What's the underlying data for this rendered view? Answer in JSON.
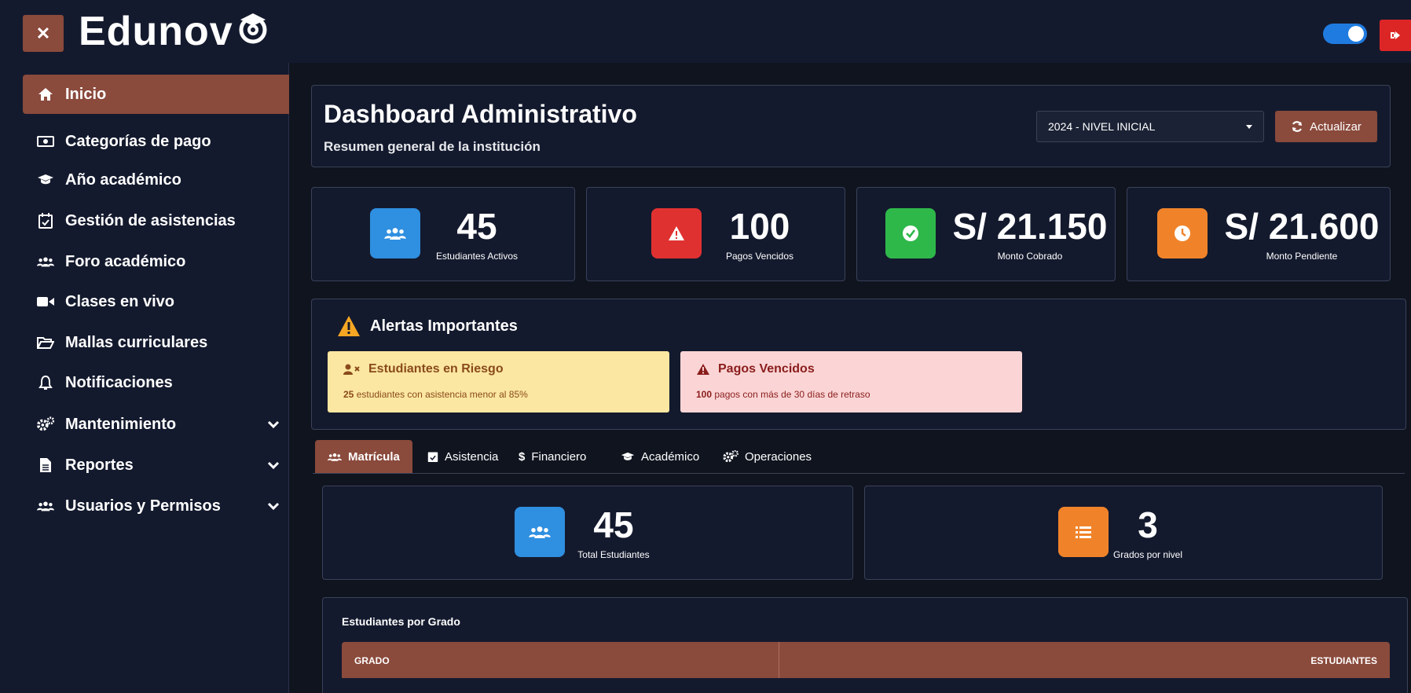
{
  "app": {
    "brand": "Edunov",
    "brand_logo_icon": "at-sign-graduation-cap-icon"
  },
  "sidebar": {
    "items": [
      {
        "label": "Inicio",
        "icon": "home-icon",
        "active": true
      },
      {
        "label": "Categorías de pago",
        "icon": "money-bill-icon"
      },
      {
        "label": "Año académico",
        "icon": "graduation-cap-icon"
      },
      {
        "label": "Gestión de asistencias",
        "icon": "calendar-check-icon"
      },
      {
        "label": "Foro académico",
        "icon": "users-icon"
      },
      {
        "label": "Clases en vivo",
        "icon": "video-camera-icon"
      },
      {
        "label": "Mallas curriculares",
        "icon": "folder-open-icon"
      },
      {
        "label": "Notificaciones",
        "icon": "bell-icon"
      },
      {
        "label": "Mantenimiento",
        "icon": "gears-icon",
        "expandable": true
      },
      {
        "label": "Reportes",
        "icon": "file-icon",
        "expandable": true
      },
      {
        "label": "Usuarios y Permisos",
        "icon": "users-icon",
        "expandable": true
      }
    ]
  },
  "header": {
    "title": "Dashboard Administrativo",
    "subtitle": "Resumen general de la institución",
    "year_select_value": "2024 - NIVEL INICIAL",
    "refresh_label": "Actualizar"
  },
  "stats": [
    {
      "value": "45",
      "label": "Estudiantes Activos",
      "icon": "users-icon",
      "color": "#2f8fe0"
    },
    {
      "value": "100",
      "label": "Pagos Vencidos",
      "icon": "warning-icon",
      "color": "#e03131"
    },
    {
      "value": "S/ 21.150",
      "label": "Monto Cobrado",
      "icon": "check-circle-icon",
      "color": "#2fb84a"
    },
    {
      "value": "S/ 21.600",
      "label": "Monto Pendiente",
      "icon": "clock-icon",
      "color": "#f0832a"
    }
  ],
  "alerts": {
    "title": "Alertas Importantes",
    "items": [
      {
        "title": "Estudiantes en Riesgo",
        "count": "25",
        "text": " estudiantes con asistencia menor al 85%",
        "bg": "#fbe7a1",
        "fg": "#8a4a1c"
      },
      {
        "title": "Pagos Vencidos",
        "count": "100",
        "text": " pagos con más de 30 días de retraso",
        "bg": "#fbd5d5",
        "fg": "#8a1c1c"
      }
    ]
  },
  "tabs": [
    {
      "label": "Matrícula",
      "icon": "users-icon",
      "active": true
    },
    {
      "label": "Asistencia",
      "icon": "calendar-check-icon"
    },
    {
      "label": "Financiero",
      "icon": "dollar-icon"
    },
    {
      "label": "Académico",
      "icon": "graduation-cap-icon"
    },
    {
      "label": "Operaciones",
      "icon": "gears-icon"
    }
  ],
  "matricula": {
    "cards": [
      {
        "value": "45",
        "label": "Total Estudiantes",
        "icon": "users-icon",
        "color": "#2f8fe0"
      },
      {
        "value": "3",
        "label": "Grados por nivel",
        "icon": "list-icon",
        "color": "#f0832a"
      }
    ],
    "table_title": "Estudiantes por Grado",
    "columns": [
      "GRADO",
      "ESTUDIANTES"
    ]
  },
  "colors": {
    "accent": "#8a4a3c",
    "background": "#141a2e",
    "toggle": "#1f7be0",
    "logout": "#dc2626"
  }
}
